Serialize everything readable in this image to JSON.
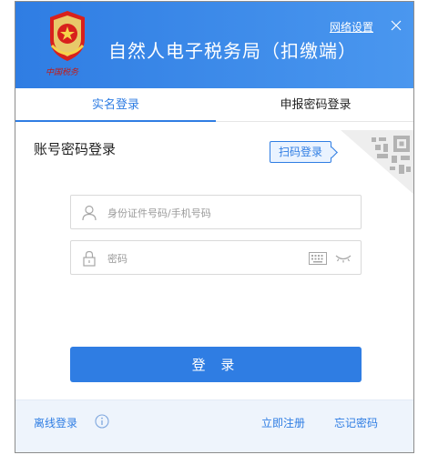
{
  "header": {
    "app_title": "自然人电子税务局（扣缴端）",
    "network_settings": "网络设置",
    "emblem_icon": "tax-emblem-icon",
    "close_icon": "close-icon",
    "brand_color": "#2f7de3"
  },
  "tabs": [
    {
      "label": "实名登录",
      "active": true
    },
    {
      "label": "申报密码登录",
      "active": false
    }
  ],
  "login": {
    "section_title": "账号密码登录",
    "qr_login_label": "扫码登录",
    "id_placeholder": "身份证件号码/手机号码",
    "password_placeholder": "密码",
    "submit_label": "登 录"
  },
  "footer": {
    "offline_login": "离线登录",
    "register": "立即注册",
    "forgot_password": "忘记密码"
  }
}
